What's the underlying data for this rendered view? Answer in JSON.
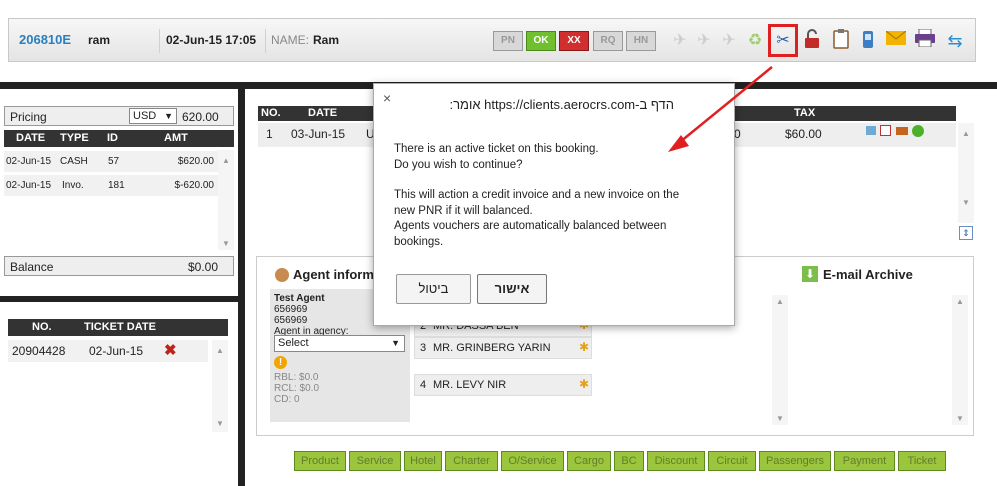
{
  "header": {
    "pnr": "206810E",
    "agent": "ram",
    "datetime": "02-Jun-15 17:05",
    "name_label": "NAME:",
    "name_value": "Ram",
    "status_buttons": [
      {
        "label": "PN",
        "bg": "#d0d0d0"
      },
      {
        "label": "OK",
        "bg": "#6fbf2f"
      },
      {
        "label": "XX",
        "bg": "#d12f2f"
      },
      {
        "label": "RQ",
        "bg": "#d0d0d0"
      },
      {
        "label": "HN",
        "bg": "#d0d0d0"
      }
    ],
    "icons": [
      "plane-icon",
      "plane-icon",
      "plane-icon",
      "recycle-icon",
      "scissors-icon",
      "unlock-icon",
      "clipboard-icon",
      "phone-icon",
      "mail-icon",
      "print-icon",
      "refresh-icon"
    ]
  },
  "pricing": {
    "label": "Pricing",
    "currency": "USD",
    "total": "620.00",
    "columns": [
      "DATE",
      "TYPE",
      "ID",
      "AMT"
    ],
    "rows": [
      {
        "date": "02-Jun-15",
        "type": "CASH",
        "id": "57",
        "amt": "$620.00"
      },
      {
        "date": "02-Jun-15",
        "type": "Invo.",
        "id": "181",
        "amt": "$-620.00"
      }
    ],
    "balance_label": "Balance",
    "balance_value": "$0.00"
  },
  "tickets": {
    "columns": [
      "NO.",
      "TICKET DATE"
    ],
    "rows": [
      {
        "no": "20904428",
        "date": "02-Jun-15"
      }
    ]
  },
  "segments": {
    "columns": [
      "NO.",
      "DATE",
      "TAX"
    ],
    "rows": [
      {
        "no": "1",
        "date": "03-Jun-15",
        "col3": "U",
        "fare_tail": "0",
        "tax": "$60.00"
      }
    ]
  },
  "agent_info": {
    "title": "Agent informa",
    "agent_name": "Test Agent",
    "line1": "656969",
    "line2": "656969",
    "agency_label": "Agent in agency:",
    "agency_select": "Select",
    "rbl": "RBL: $0.0",
    "rcl": "RCL: $0.0",
    "cd": "CD: 0"
  },
  "passengers": [
    {
      "no": "2",
      "name": "MR. DASSA BEN"
    },
    {
      "no": "3",
      "name": "MR. GRINBERG YARIN"
    },
    {
      "no": "4",
      "name": "MR. LEVY NIR"
    }
  ],
  "email_archive": {
    "title": "E-mail Archive"
  },
  "bottom_tabs": [
    "Product",
    "Service",
    "Hotel",
    "Charter",
    "O/Service",
    "Cargo",
    "BC",
    "Discount",
    "Circuit",
    "Passengers",
    "Payment",
    "Ticket"
  ],
  "dialog": {
    "title": "הדף ב-https://clients.aerocrs.com אומר:",
    "line1": "There is an active ticket on this booking.",
    "line2": "Do you wish to continue?",
    "line3": "This will action a credit invoice and a new invoice on the",
    "line4": "new PNR if it will balanced.",
    "line5": "Agents vouchers are automatically  balanced between",
    "line6": "bookings.",
    "ok_label": "אישור",
    "cancel_label": "ביטול",
    "close_glyph": "×"
  }
}
